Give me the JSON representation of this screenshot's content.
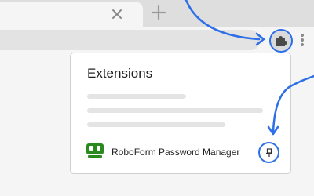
{
  "browser": {
    "tab_close_icon": "close-icon",
    "new_tab_icon": "plus-icon",
    "extensions_button_icon": "puzzle-piece-icon",
    "menu_icon": "vertical-dots-icon"
  },
  "extensions_panel": {
    "title": "Extensions",
    "extension": {
      "name": "RoboForm Password Manager",
      "icon": "roboform-robot-icon",
      "pin_icon": "pin-icon"
    }
  },
  "colors": {
    "highlight_blue": "#2d6fe8",
    "roboform_green": "#2a8a1e"
  }
}
